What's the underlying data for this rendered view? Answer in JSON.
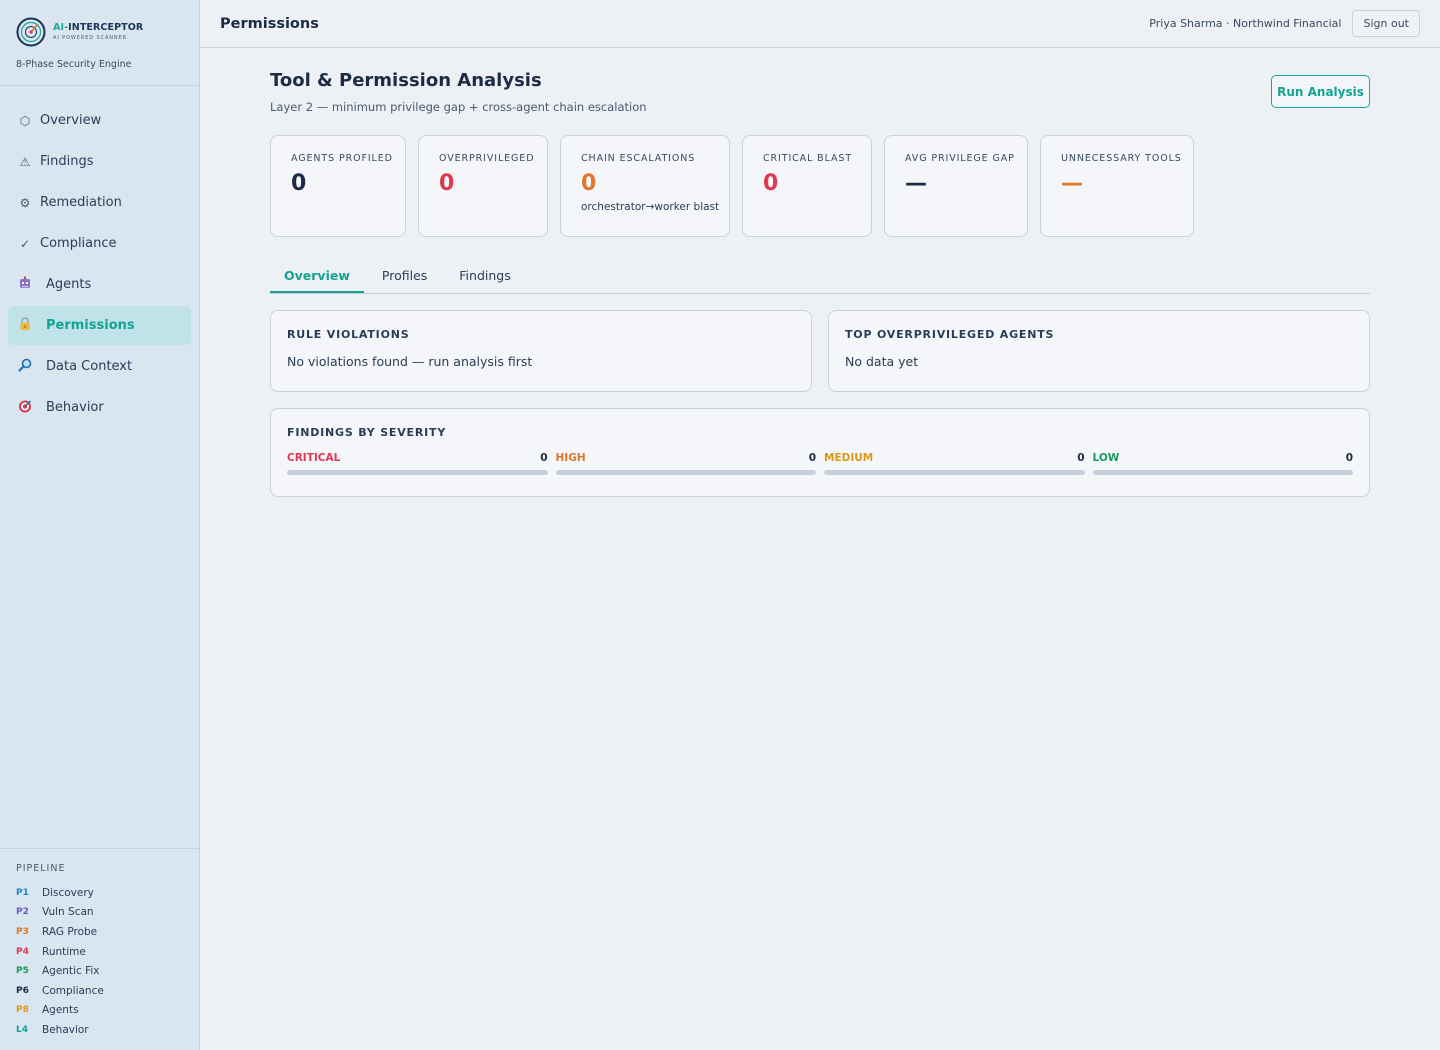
{
  "brand": {
    "name_ai": "AI-",
    "name_rest": "INTERCEPTOR",
    "tagline": "AI POWERED SCANNER",
    "engine": "8-Phase Security Engine"
  },
  "nav": [
    {
      "label": "Overview",
      "icon": "hexagon-icon"
    },
    {
      "label": "Findings",
      "icon": "warning-icon"
    },
    {
      "label": "Remediation",
      "icon": "gear-icon"
    },
    {
      "label": "Compliance",
      "icon": "checkmark-icon"
    },
    {
      "label": "Agents",
      "icon": "robot-icon"
    },
    {
      "label": "Permissions",
      "icon": "lock-icon",
      "active": true
    },
    {
      "label": "Data Context",
      "icon": "magnifier-icon"
    },
    {
      "label": "Behavior",
      "icon": "target-icon"
    }
  ],
  "pipeline": {
    "title": "PIPELINE",
    "items": [
      {
        "code": "P1",
        "label": "Discovery",
        "color": "#1a87c4"
      },
      {
        "code": "P2",
        "label": "Vuln Scan",
        "color": "#6a5acd"
      },
      {
        "code": "P3",
        "label": "RAG Probe",
        "color": "#e0762a"
      },
      {
        "code": "P4",
        "label": "Runtime",
        "color": "#e0384f"
      },
      {
        "code": "P5",
        "label": "Agentic Fix",
        "color": "#1a9a5a"
      },
      {
        "code": "P6",
        "label": "Compliance",
        "color": "#1d2b45"
      },
      {
        "code": "P8",
        "label": "Agents",
        "color": "#d99a1a"
      },
      {
        "code": "L4",
        "label": "Behavior",
        "color": "#14a392"
      }
    ]
  },
  "topbar": {
    "title": "Permissions",
    "user": "Priya Sharma · Northwind Financial",
    "signout": "Sign out"
  },
  "page": {
    "title": "Tool & Permission Analysis",
    "subtitle": "Layer 2 — minimum privilege gap + cross-agent chain escalation",
    "run_button": "Run Analysis"
  },
  "stats": [
    {
      "label": "AGENTS PROFILED",
      "value": "0",
      "color": "#1d2b45",
      "note": ""
    },
    {
      "label": "OVERPRIVILEGED",
      "value": "0",
      "color": "#e0384f",
      "note": ""
    },
    {
      "label": "CHAIN ESCALATIONS",
      "value": "0",
      "color": "#e0762a",
      "note": "orchestrator→worker blast"
    },
    {
      "label": "CRITICAL BLAST",
      "value": "0",
      "color": "#e0384f",
      "note": ""
    },
    {
      "label": "AVG PRIVILEGE GAP",
      "value": "—",
      "color": "#1d2b45",
      "note": ""
    },
    {
      "label": "UNNECESSARY TOOLS",
      "value": "—",
      "color": "#e0762a",
      "note": ""
    }
  ],
  "tabs": [
    "Overview",
    "Profiles",
    "Findings"
  ],
  "panels": {
    "violations": {
      "title": "RULE VIOLATIONS",
      "text": "No violations found — run analysis first"
    },
    "top_agents": {
      "title": "TOP OVERPRIVILEGED AGENTS",
      "text": "No data yet"
    }
  },
  "severity": {
    "title": "FINDINGS BY SEVERITY",
    "items": [
      {
        "label": "CRITICAL",
        "count": "0",
        "color": "#e0384f"
      },
      {
        "label": "HIGH",
        "count": "0",
        "color": "#e0762a"
      },
      {
        "label": "MEDIUM",
        "count": "0",
        "color": "#d99a1a"
      },
      {
        "label": "LOW",
        "count": "0",
        "color": "#1a9a5a"
      }
    ]
  }
}
